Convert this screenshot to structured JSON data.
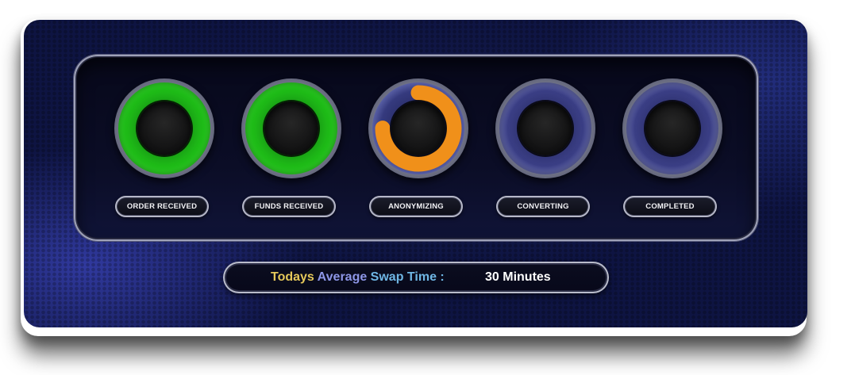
{
  "steps": [
    {
      "label": "ORDER RECEIVED",
      "state": "completed",
      "color": "#22c91b",
      "progress": 1.0
    },
    {
      "label": "FUNDS RECEIVED",
      "state": "completed",
      "color": "#22c91b",
      "progress": 1.0
    },
    {
      "label": "ANONYMIZING",
      "state": "in-progress",
      "color": "#f0901a",
      "progress": 0.75
    },
    {
      "label": "CONVERTING",
      "state": "pending",
      "color": "#3b3f86",
      "progress": 0
    },
    {
      "label": "COMPLETED",
      "state": "pending",
      "color": "#3b3f86",
      "progress": 0
    }
  ],
  "swap_time": {
    "label_part1": "Todays",
    "label_part2": " Average",
    "label_part3": " Swap Time :",
    "value": "30 Minutes"
  },
  "colors": {
    "complete": "#22c91b",
    "in_progress": "#f0901a",
    "pending": "#3b3f86",
    "label_gold": "#e5c85a",
    "label_violet": "#8d96e6",
    "label_cyan": "#6fb6e4"
  }
}
